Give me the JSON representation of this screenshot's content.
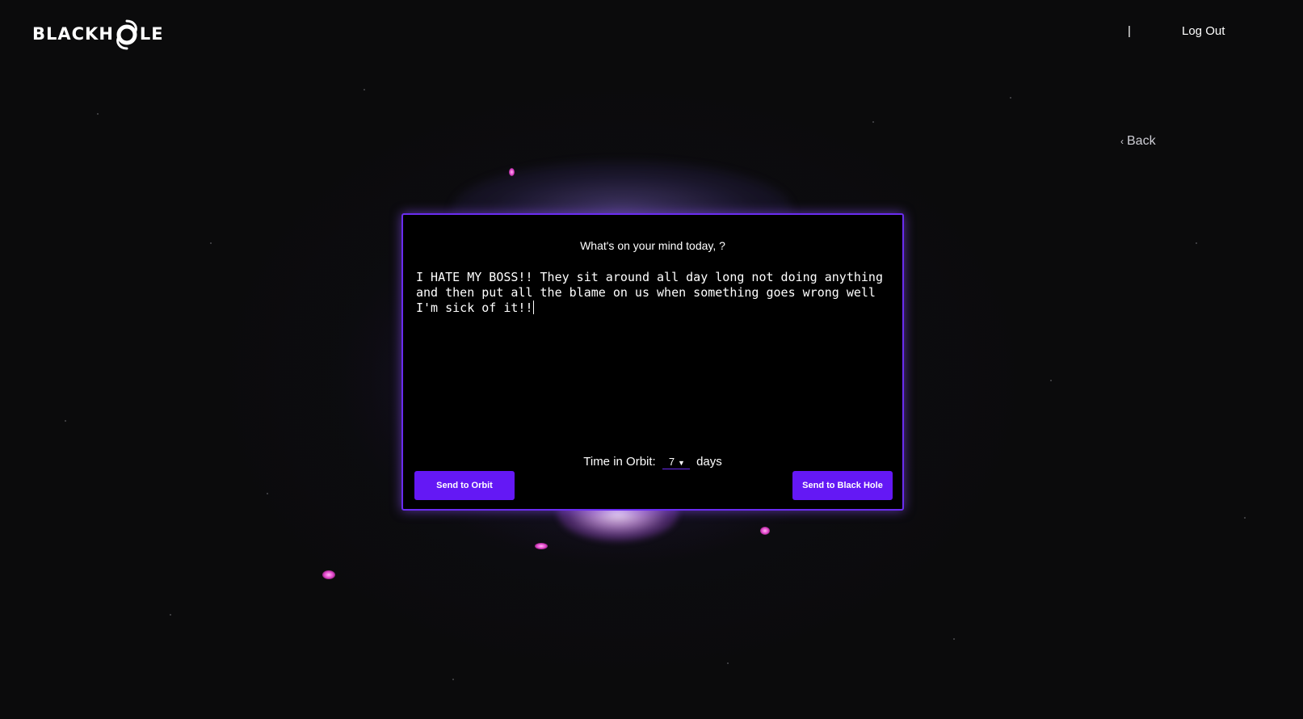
{
  "header": {
    "logo_text_left": "BLACKH",
    "logo_text_right": "LE",
    "logo_icon": "swirl-o-icon",
    "separator": "|",
    "logout_label": "Log Out"
  },
  "nav": {
    "back_icon": "chevron-left-icon",
    "back_label": "Back"
  },
  "composer": {
    "prompt": "What's on your mind today, ?",
    "entry_text": "I HATE MY BOSS!! They sit around all day long not doing anything and then put all the blame on us when something goes wrong well I'm sick of it!!",
    "orbit_label": "Time in Orbit:",
    "orbit_value": "7",
    "orbit_unit": "days",
    "send_orbit_label": "Send to Orbit",
    "send_blackhole_label": "Send to Black Hole"
  },
  "colors": {
    "accent": "#6418f5",
    "card_border": "#6a2cf0",
    "background": "#0b0b0c"
  }
}
